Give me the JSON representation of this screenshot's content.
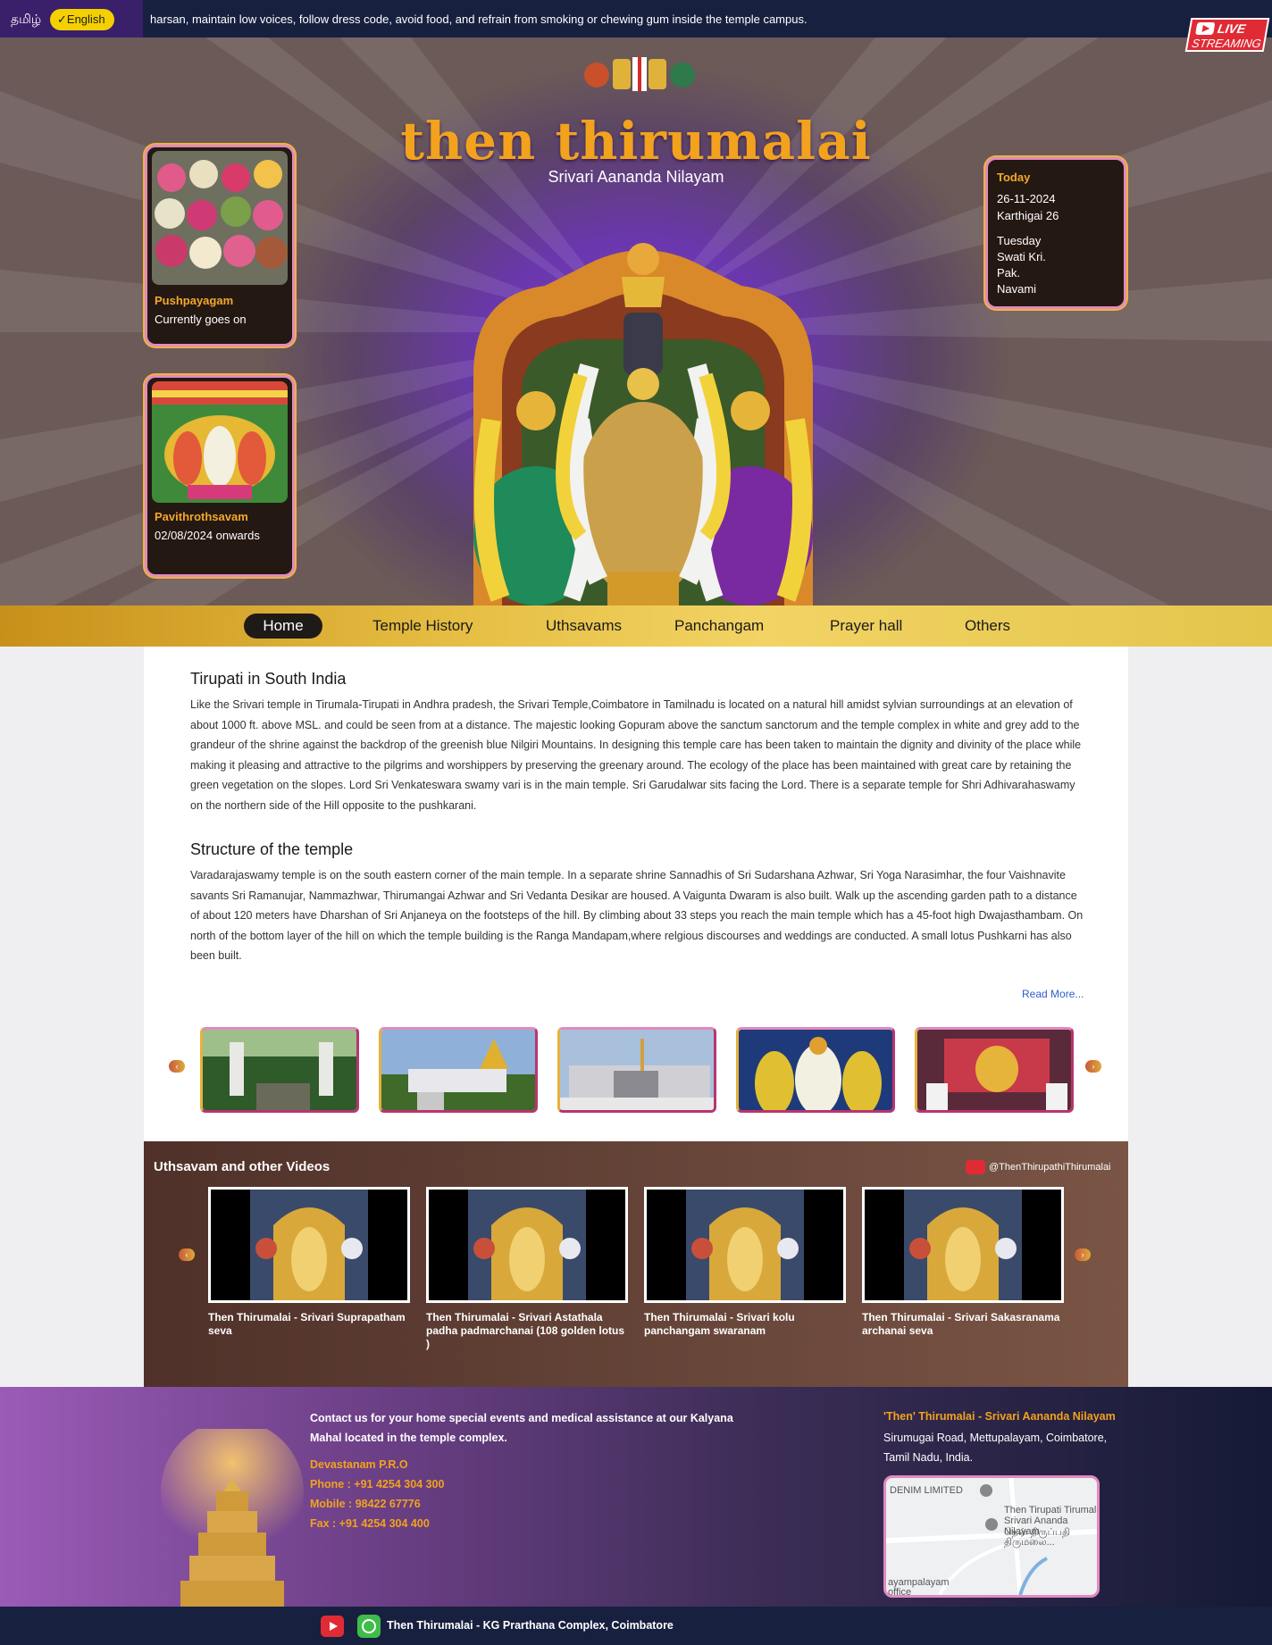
{
  "topbar": {
    "lang_tamil": "தமிழ்",
    "lang_english": "English",
    "ticker": "harsan, maintain low voices, follow dress code, avoid food, and refrain from smoking or chewing gum inside the temple campus."
  },
  "live": {
    "line1": "LIVE",
    "line2": "STREAMING"
  },
  "hero": {
    "brand": "then thirumalai",
    "subtitle": "Srivari Aananda Nilayam",
    "events": [
      {
        "title": "Pushpayagam",
        "status": "Currently goes on"
      },
      {
        "title": "Pavithrothsavam",
        "status": "02/08/2024 onwards"
      }
    ],
    "today": {
      "heading": "Today",
      "date": "26-11-2024",
      "tamil_date": "Karthigai 26",
      "day": "Tuesday",
      "nakshatra": "Swati Kri.",
      "paksha": "Pak.",
      "tithi": "Navami"
    }
  },
  "nav": {
    "items": [
      "Home",
      "Temple History",
      "Uthsavams",
      "Panchangam",
      "Prayer hall",
      "Others"
    ],
    "active": "Home"
  },
  "content": {
    "section1_title": "Tirupati in South India",
    "section1_text": "Like the Srivari temple in Tirumala-Tirupati in Andhra pradesh, the Srivari Temple,Coimbatore in Tamilnadu is located on a natural hill amidst sylvian surroundings at an elevation of about 1000 ft. above MSL. and could be seen from at a distance. The majestic looking Gopuram above the sanctum sanctorum and the temple complex in white and grey add to the grandeur of the shrine against the backdrop of the greenish blue Nilgiri Mountains. In designing this temple care has been taken to maintain the dignity and divinity of the place while making it pleasing and attractive to the pilgrims and worshippers by preserving the greenary around. The ecology of the place has been maintained with great care by retaining the green vegetation on the slopes. Lord Sri Venkateswara swamy vari is in the main temple. Sri Garudalwar sits facing the Lord. There is a separate temple for Shri Adhivarahaswamy on the northern side of the Hill opposite to the pushkarani.",
    "section2_title": "Structure of the temple",
    "section2_text": "Varadarajaswamy temple is on the south eastern corner of the main temple. In a separate shrine Sannadhis of Sri Sudarshana Azhwar, Sri Yoga Narasimhar, the four Vaishnavite savants Sri Ramanujar, Nammazhwar, Thirumangai Azhwar and Sri Vedanta Desikar are housed. A Vaigunta Dwaram is also built. Walk up the ascending garden path to a distance of about 120 meters have Dharshan of Sri Anjaneya on the footsteps of the hill. By climbing about 33 steps you reach the main temple which has a 45-foot high Dwajasthambam. On north of the bottom layer of the hill on which the temple building is the Ranga Mandapam,where relgious discourses and weddings are conducted. A small lotus Pushkarni has also been built.",
    "read_more": "Read More..."
  },
  "videos": {
    "title": "Uthsavam and other Videos",
    "channel": "@ThenThirupathiThirumalai",
    "items": [
      "Then Thirumalai - Srivari Suprapatham seva",
      "Then Thirumalai - Srivari Astathala padha padmarchanai (108 golden lotus )",
      "Then Thirumalai - Srivari kolu panchangam swaranam",
      "Then Thirumalai - Srivari Sakasranama archanai seva"
    ]
  },
  "footer": {
    "contact": "Contact us for your home special events and medical assistance at our Kalyana Mahal located in the temple complex.",
    "pro": "Devastanam P.R.O",
    "phone": "Phone : +91 4254 304 300",
    "mobile": "Mobile : 98422 67776",
    "fax": "Fax : +91 4254 304 400",
    "address_title": "'Then' Thirumalai - Srivari Aananda Nilayam",
    "address": "Sirumugai Road, Mettupalayam, Coimbatore, Tamil Nadu, India.",
    "map_labels": {
      "denim": "DENIM LIMITED",
      "temple": "Then Tirupati Tirumala Srivari Ananda Nilayam",
      "tamil": "தென் திருப்பதி திருமலை...",
      "bottom": "ayampalayam office"
    }
  },
  "bottombar": {
    "text": "Then Thirumalai - KG Prarthana Complex, Coimbatore"
  },
  "colors": {
    "gold": "#f2a21d",
    "purple": "#6a37ae",
    "navy": "#17203f",
    "accent_pink": "#e08ac0"
  }
}
